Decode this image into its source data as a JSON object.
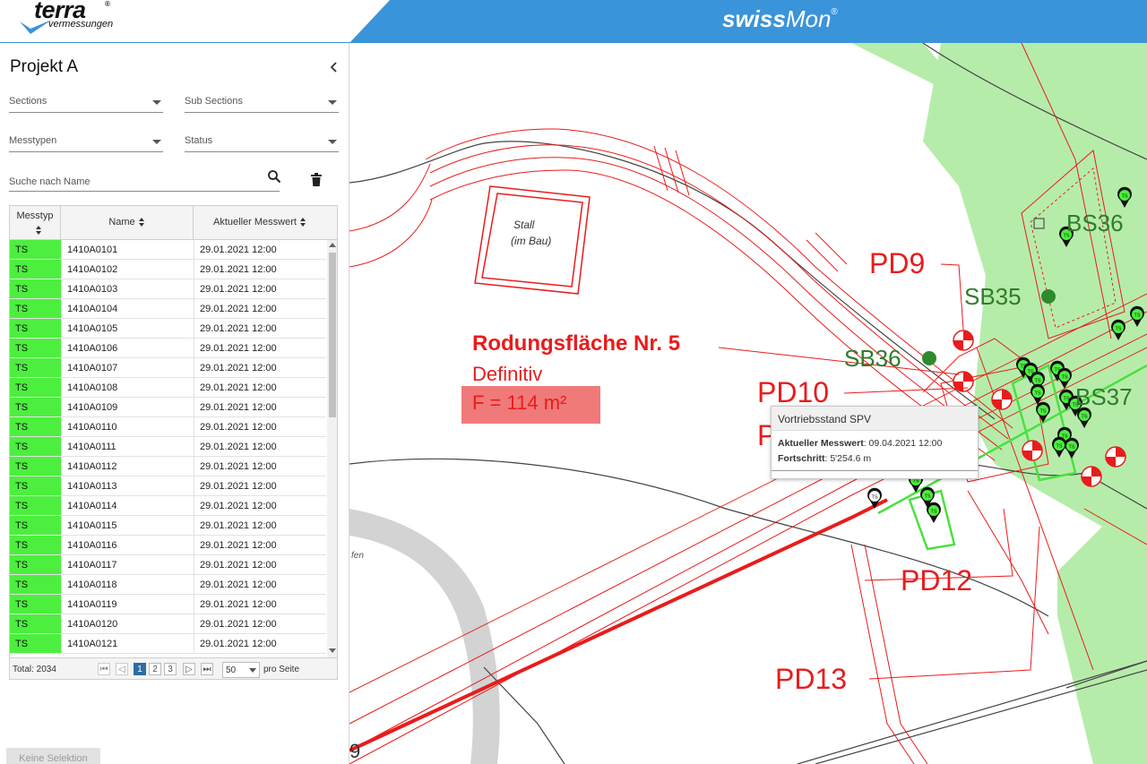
{
  "header": {
    "logo_main": "terra",
    "logo_reg": "®",
    "logo_sub": "vermessungen",
    "app_name_bold": "swiss",
    "app_name_light": "Mon",
    "app_name_reg": "®",
    "colors": {
      "brand_blue": "#3a94d9",
      "status_green": "#4cef3e",
      "map_red": "#e81c1c",
      "map_green": "#b6ecaa"
    }
  },
  "sidebar": {
    "project_title": "Projekt A",
    "collapse_icon": "chevron-left-icon",
    "filters": {
      "sections": "Sections",
      "sub_sections": "Sub Sections",
      "messtypen": "Messtypen",
      "status": "Status"
    },
    "search_placeholder": "Suche nach Name",
    "no_selection": "Keine Selektion"
  },
  "grid": {
    "columns": [
      {
        "label": "Messtyp"
      },
      {
        "label": "Name"
      },
      {
        "label": "Aktueller Messwert"
      }
    ],
    "rows": [
      {
        "type": "TS",
        "name": "1410A0101",
        "value": "29.01.2021 12:00"
      },
      {
        "type": "TS",
        "name": "1410A0102",
        "value": "29.01.2021 12:00"
      },
      {
        "type": "TS",
        "name": "1410A0103",
        "value": "29.01.2021 12:00"
      },
      {
        "type": "TS",
        "name": "1410A0104",
        "value": "29.01.2021 12:00"
      },
      {
        "type": "TS",
        "name": "1410A0105",
        "value": "29.01.2021 12:00"
      },
      {
        "type": "TS",
        "name": "1410A0106",
        "value": "29.01.2021 12:00"
      },
      {
        "type": "TS",
        "name": "1410A0107",
        "value": "29.01.2021 12:00"
      },
      {
        "type": "TS",
        "name": "1410A0108",
        "value": "29.01.2021 12:00"
      },
      {
        "type": "TS",
        "name": "1410A0109",
        "value": "29.01.2021 12:00"
      },
      {
        "type": "TS",
        "name": "1410A0110",
        "value": "29.01.2021 12:00"
      },
      {
        "type": "TS",
        "name": "1410A0111",
        "value": "29.01.2021 12:00"
      },
      {
        "type": "TS",
        "name": "1410A0112",
        "value": "29.01.2021 12:00"
      },
      {
        "type": "TS",
        "name": "1410A0113",
        "value": "29.01.2021 12:00"
      },
      {
        "type": "TS",
        "name": "1410A0114",
        "value": "29.01.2021 12:00"
      },
      {
        "type": "TS",
        "name": "1410A0115",
        "value": "29.01.2021 12:00"
      },
      {
        "type": "TS",
        "name": "1410A0116",
        "value": "29.01.2021 12:00"
      },
      {
        "type": "TS",
        "name": "1410A0117",
        "value": "29.01.2021 12:00"
      },
      {
        "type": "TS",
        "name": "1410A0118",
        "value": "29.01.2021 12:00"
      },
      {
        "type": "TS",
        "name": "1410A0119",
        "value": "29.01.2021 12:00"
      },
      {
        "type": "TS",
        "name": "1410A0120",
        "value": "29.01.2021 12:00"
      },
      {
        "type": "TS",
        "name": "1410A0121",
        "value": "29.01.2021 12:00"
      }
    ],
    "pager": {
      "total": "Total: 2034",
      "pages": [
        "1",
        "2",
        "3"
      ],
      "active_page": "1",
      "per_page": "50",
      "per_page_label": "pro Seite"
    }
  },
  "map": {
    "labels": {
      "stall_1": "Stall",
      "stall_2": "(im Bau)",
      "rodung_title": "Rodungsfläche Nr. 5",
      "rodung_sub": "Definitiv",
      "rodung_area": "F = 114 m²",
      "pd9": "PD9",
      "pd10": "PD10",
      "pd_partial": "P",
      "pd12": "PD12",
      "pd13": "PD13",
      "sb35": "SB35",
      "sb36": "SB36",
      "bs36": "BS36",
      "bs37": "BS37",
      "street_fragment": "fen",
      "corner_number": "9"
    },
    "marker_label": "TS",
    "tooltip": {
      "title": "Vortriebsstand SPV",
      "value_label": "Aktueller Messwert",
      "value": ": 09.04.2021 12:00",
      "progress_label": "Fortschritt",
      "progress": ": 5'254.6 m"
    }
  }
}
